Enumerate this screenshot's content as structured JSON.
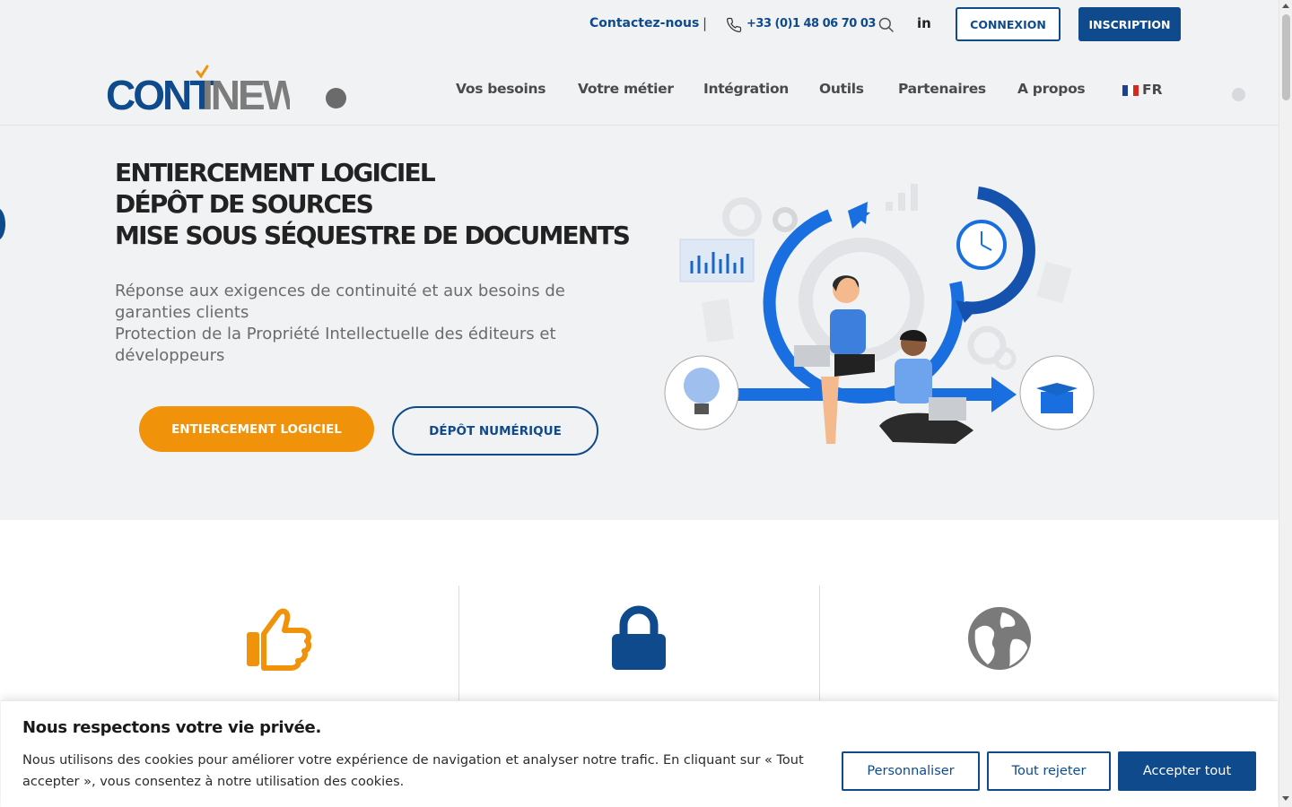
{
  "topbar": {
    "contact_label": "Contactez-nous",
    "separator": "|",
    "phone": "+33 (0)1 48 06 70 03",
    "linkedin_label": "in",
    "login_label": "CONNEXION",
    "signup_label": "INSCRIPTION"
  },
  "nav": {
    "items": [
      "Vos besoins",
      "Votre métier",
      "Intégration",
      "Outils",
      "Partenaires",
      "A propos"
    ],
    "language": "FR"
  },
  "hero": {
    "title_lines": [
      "ENTIERCEMENT LOGICIEL",
      "DÉPÔT DE SOURCES",
      "MISE SOUS SÉQUESTRE DE DOCUMENTS"
    ],
    "subtitle_lines": [
      "Réponse aux exigences de continuité et aux besoins de garanties clients",
      "Protection de la Propriété Intellectuelle des éditeurs et développeurs"
    ],
    "primary_button": "ENTIERCEMENT LOGICIEL",
    "secondary_button": "DÉPÔT NUMÉRIQUE"
  },
  "features": [
    {
      "icon": "thumbs-up-icon",
      "color": "#f0930a"
    },
    {
      "icon": "lock-icon",
      "color": "#0f4a8c"
    },
    {
      "icon": "globe-icon",
      "color": "#7a7a7a"
    }
  ],
  "cookie": {
    "title": "Nous respectons votre vie privée.",
    "text": "Nous utilisons des cookies pour améliorer votre expérience de navigation et analyser notre trafic. En cliquant sur « Tout accepter », vous consentez à notre utilisation des cookies.",
    "customize_label": "Personnaliser",
    "reject_label": "Tout rejeter",
    "accept_label": "Accepter tout"
  },
  "colors": {
    "brand_blue": "#0f4a8c",
    "brand_orange": "#f0930a",
    "hero_bg": "#f1f2f4"
  }
}
